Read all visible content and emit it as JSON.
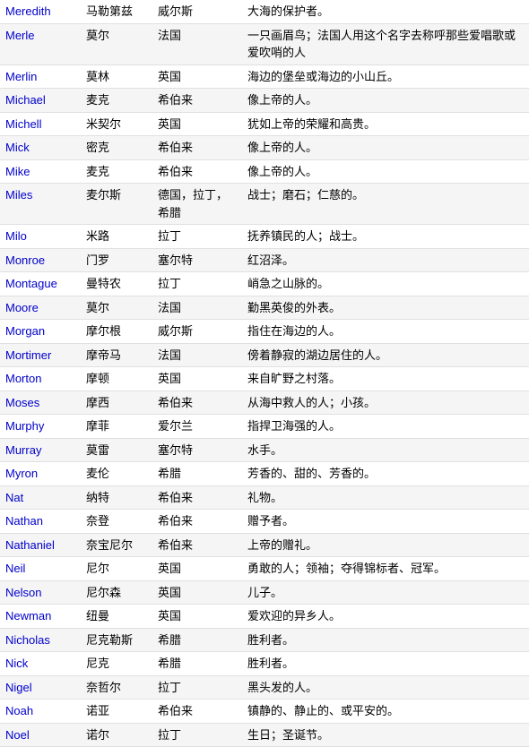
{
  "rows": [
    {
      "name": "Meredith",
      "chinese": "马勒第兹",
      "origin": "威尔斯",
      "meaning": "大海的保护者。"
    },
    {
      "name": "Merle",
      "chinese": "莫尔",
      "origin": "法国",
      "meaning": "一只画眉鸟；法国人用这个名字去称呼那些爱唱歌或爱吹哨的人"
    },
    {
      "name": "Merlin",
      "chinese": "莫林",
      "origin": "英国",
      "meaning": "海边的堡垒或海边的小山丘。"
    },
    {
      "name": "Michael",
      "chinese": "麦克",
      "origin": "希伯来",
      "meaning": "像上帝的人。"
    },
    {
      "name": "Michell",
      "chinese": "米契尔",
      "origin": "英国",
      "meaning": "犹如上帝的荣耀和高贵。"
    },
    {
      "name": "Mick",
      "chinese": "密克",
      "origin": "希伯来",
      "meaning": "像上帝的人。"
    },
    {
      "name": "Mike",
      "chinese": "麦克",
      "origin": "希伯来",
      "meaning": "像上帝的人。"
    },
    {
      "name": "Miles",
      "chinese": "麦尔斯",
      "origin": "德国，拉丁，希腊",
      "meaning": "战士；磨石；仁慈的。"
    },
    {
      "name": "Milo",
      "chinese": "米路",
      "origin": "拉丁",
      "meaning": "抚养镇民的人；战士。"
    },
    {
      "name": "Monroe",
      "chinese": "门罗",
      "origin": "塞尔特",
      "meaning": "红沼泽。"
    },
    {
      "name": "Montague",
      "chinese": "曼特农",
      "origin": "拉丁",
      "meaning": "峭急之山脉的。"
    },
    {
      "name": "Moore",
      "chinese": "莫尔",
      "origin": "法国",
      "meaning": "勤黑英俊的外表。"
    },
    {
      "name": "Morgan",
      "chinese": "摩尔根",
      "origin": "威尔斯",
      "meaning": "指住在海边的人。"
    },
    {
      "name": "Mortimer",
      "chinese": "摩帝马",
      "origin": "法国",
      "meaning": "傍着静寂的湖边居住的人。"
    },
    {
      "name": "Morton",
      "chinese": "摩顿",
      "origin": "英国",
      "meaning": "来自旷野之村落。"
    },
    {
      "name": "Moses",
      "chinese": "摩西",
      "origin": "希伯来",
      "meaning": "从海中救人的人；小孩。"
    },
    {
      "name": "Murphy",
      "chinese": "摩菲",
      "origin": "爱尔兰",
      "meaning": "指捍卫海强的人。"
    },
    {
      "name": "Murray",
      "chinese": "莫雷",
      "origin": "塞尔特",
      "meaning": "水手。"
    },
    {
      "name": "Myron",
      "chinese": "麦伦",
      "origin": "希腊",
      "meaning": "芳香的、甜的、芳香的。"
    },
    {
      "name": "Nat",
      "chinese": "纳特",
      "origin": "希伯来",
      "meaning": "礼物。"
    },
    {
      "name": "Nathan",
      "chinese": "奈登",
      "origin": "希伯来",
      "meaning": "赠予者。"
    },
    {
      "name": "Nathaniel",
      "chinese": "奈宝尼尔",
      "origin": "希伯来",
      "meaning": "上帝的赠礼。"
    },
    {
      "name": "Neil",
      "chinese": "尼尔",
      "origin": "英国",
      "meaning": "勇敢的人；领袖；夺得锦标者、冠军。"
    },
    {
      "name": "Nelson",
      "chinese": "尼尔森",
      "origin": "英国",
      "meaning": "儿子。"
    },
    {
      "name": "Newman",
      "chinese": "纽曼",
      "origin": "英国",
      "meaning": "爱欢迎的异乡人。"
    },
    {
      "name": "Nicholas",
      "chinese": "尼克勒斯",
      "origin": "希腊",
      "meaning": "胜利者。"
    },
    {
      "name": "Nick",
      "chinese": "尼克",
      "origin": "希腊",
      "meaning": "胜利者。"
    },
    {
      "name": "Nigel",
      "chinese": "奈哲尔",
      "origin": "拉丁",
      "meaning": "黑头发的人。"
    },
    {
      "name": "Noah",
      "chinese": "诺亚",
      "origin": "希伯来",
      "meaning": "镇静的、静止的、或平安的。"
    },
    {
      "name": "Noel",
      "chinese": "诺尔",
      "origin": "拉丁",
      "meaning": "生日；圣诞节。"
    }
  ]
}
